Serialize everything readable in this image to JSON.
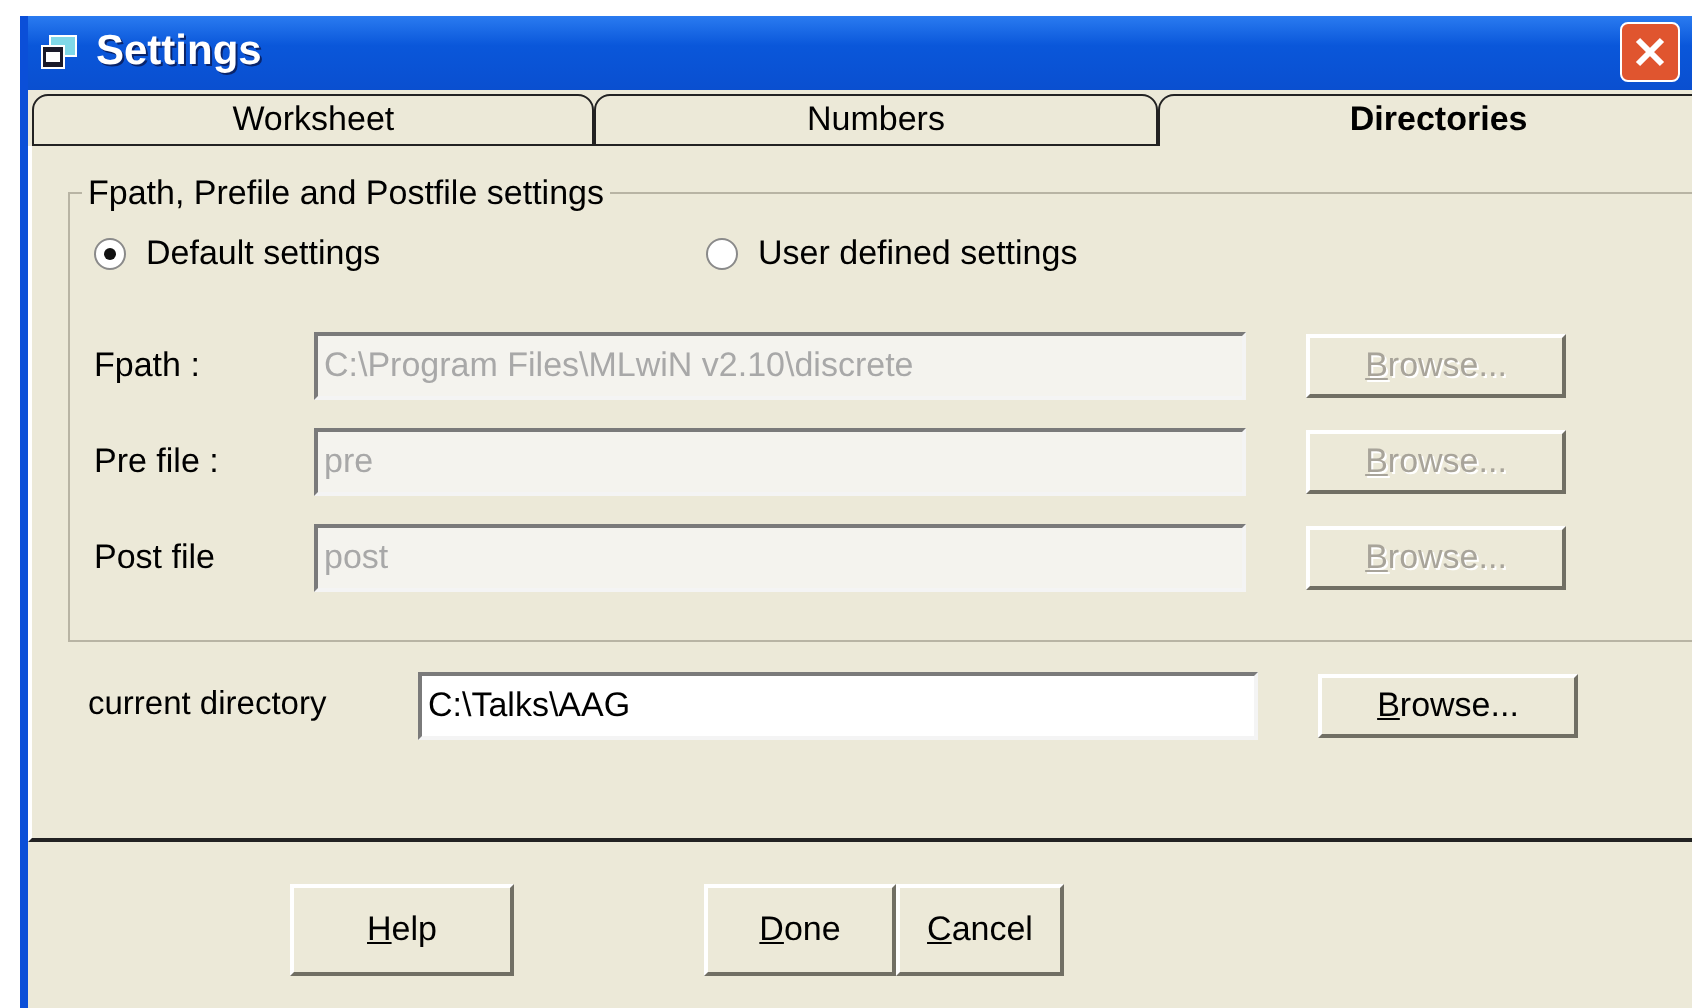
{
  "window": {
    "title": "Settings"
  },
  "tabs": [
    {
      "label": "Worksheet",
      "selected": false
    },
    {
      "label": "Numbers",
      "selected": false
    },
    {
      "label": "Directories",
      "selected": true
    }
  ],
  "group": {
    "title": "Fpath, Prefile and Postfile settings",
    "radios": [
      {
        "label": "Default settings",
        "selected": true
      },
      {
        "label": "User defined settings",
        "selected": false
      }
    ],
    "fields": [
      {
        "label": "Fpath :",
        "value": "C:\\Program Files\\MLwiN v2.10\\discrete",
        "disabled": true,
        "button": "Browse..."
      },
      {
        "label": "Pre file :",
        "value": "pre",
        "disabled": true,
        "button": "Browse..."
      },
      {
        "label": "Post file",
        "value": "post",
        "disabled": true,
        "button": "Browse..."
      }
    ]
  },
  "current_directory": {
    "label": "current directory",
    "value": "C:\\Talks\\AAG",
    "disabled": false,
    "button": "Browse..."
  },
  "buttons": [
    {
      "label": "Help"
    },
    {
      "label": "Done"
    },
    {
      "label": "Cancel"
    }
  ]
}
